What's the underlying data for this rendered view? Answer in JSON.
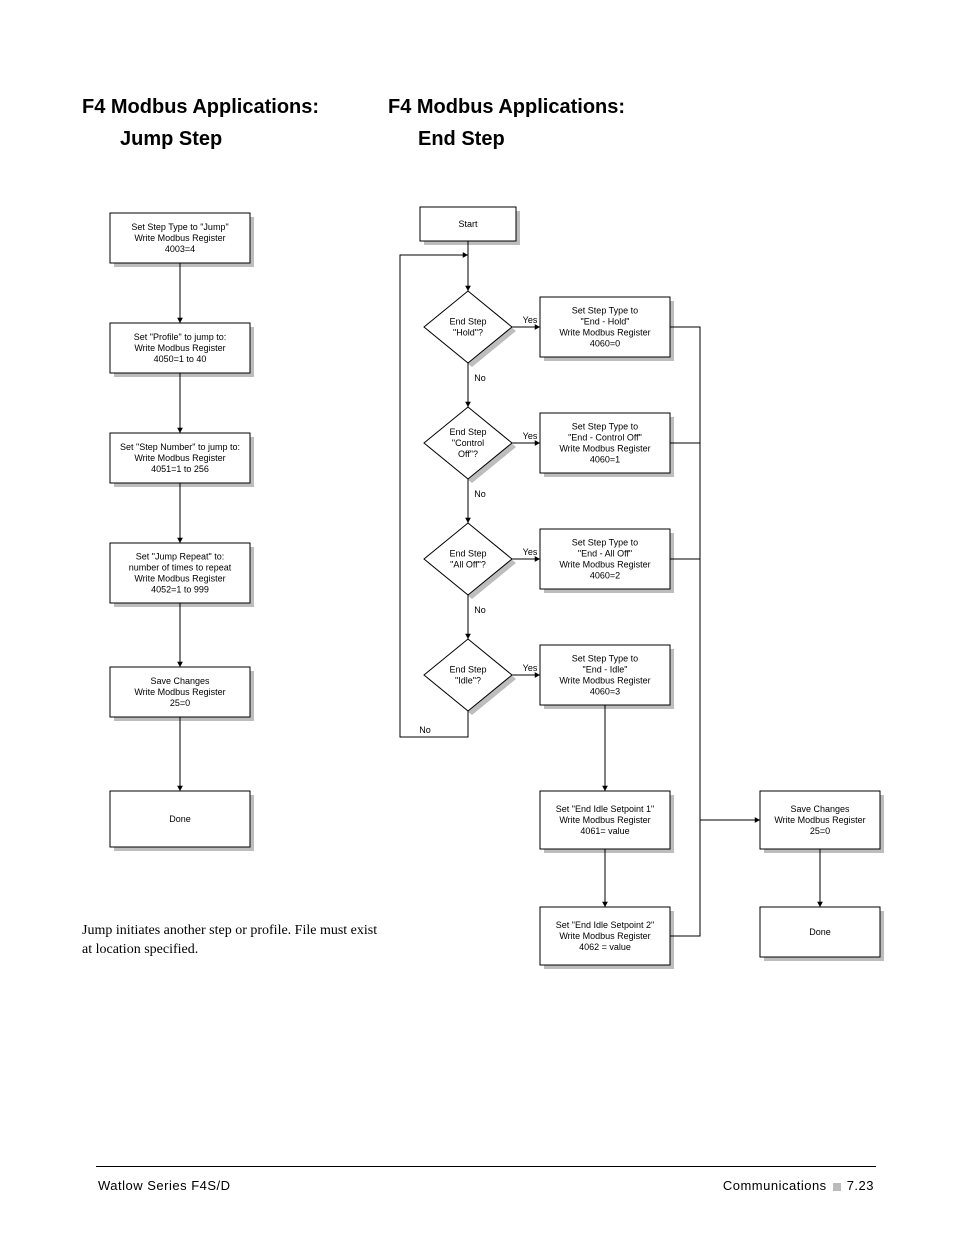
{
  "titles": {
    "left_a": "F4 Modbus Applications:",
    "left_b": "Jump Step",
    "right_a": "F4 Modbus Applications:",
    "right_b": "End Step"
  },
  "caption": "Jump initiates another step or profile. File must exist at location specified.",
  "footer": {
    "left": "Watlow Series F4S/D",
    "right_a": "Communications",
    "right_b": "7.23"
  },
  "labels": {
    "yes": "Yes",
    "no": "No"
  },
  "jump": {
    "b1": [
      "Set Step Type to \"Jump\"",
      "Write Modbus Register",
      "4003=4"
    ],
    "b2": [
      "Set \"Profile\" to jump to:",
      "Write Modbus Register",
      "4050=1 to 40"
    ],
    "b3": [
      "Set \"Step Number\" to jump to:",
      "Write Modbus Register",
      "4051=1 to 256"
    ],
    "b4": [
      "Set \"Jump Repeat\" to:",
      "number of times to repeat",
      "Write Modbus Register",
      "4052=1 to 999"
    ],
    "b5": [
      "Save Changes",
      "Write Modbus Register",
      "25=0"
    ],
    "b6": [
      "Done"
    ]
  },
  "end": {
    "start": [
      "Start"
    ],
    "d1": [
      "End Step",
      "\"Hold\"?"
    ],
    "d2": [
      "End Step",
      "\"Control",
      "Off\"?"
    ],
    "d3": [
      "End Step",
      "\"All Off\"?"
    ],
    "d4": [
      "End Step",
      "\"Idle\"?"
    ],
    "r1": [
      "Set Step Type  to",
      "\"End - Hold\"",
      "Write Modbus Register",
      "4060=0"
    ],
    "r2": [
      "Set Step Type  to",
      "\"End - Control Off\"",
      "Write Modbus Register",
      "4060=1"
    ],
    "r3": [
      "Set Step Type  to",
      "\"End - All Off\"",
      "Write Modbus Register",
      "4060=2"
    ],
    "r4": [
      "Set Step Type to",
      "\"End - Idle\"",
      "Write Modbus Register",
      "4060=3"
    ],
    "r5": [
      "Set \"End Idle Setpoint 1\"",
      "Write Modbus Register",
      "4061= value"
    ],
    "r6": [
      "Set \"End Idle Setpoint 2\"",
      "Write Modbus Register",
      "4062 = value"
    ],
    "save": [
      "Save Changes",
      "Write Modbus Register",
      "25=0"
    ],
    "done": [
      "Done"
    ]
  }
}
